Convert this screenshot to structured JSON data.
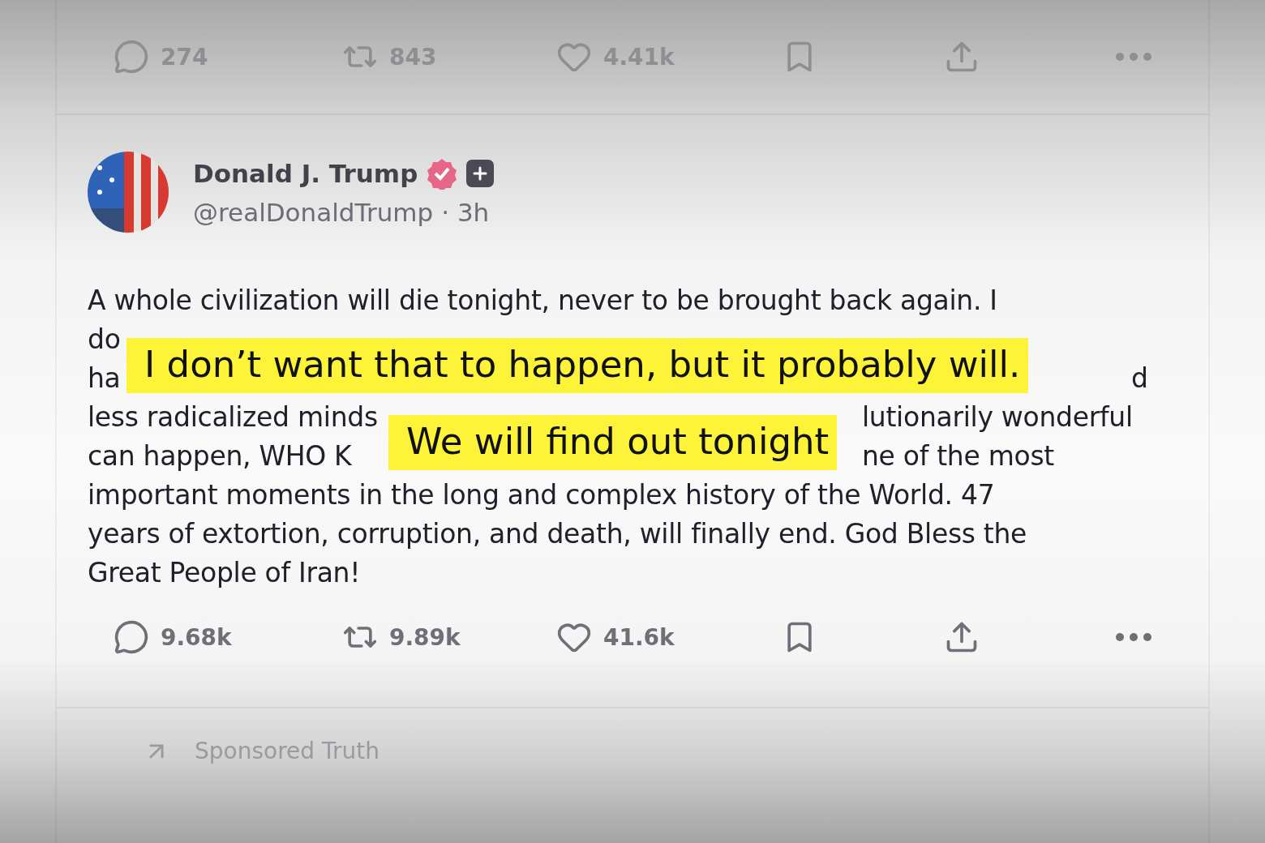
{
  "previous_post_actions": [
    {
      "kind": "reply",
      "count": "274"
    },
    {
      "kind": "repost",
      "count": "843"
    },
    {
      "kind": "like",
      "count": "4.41k"
    },
    {
      "kind": "bookmark"
    },
    {
      "kind": "share"
    },
    {
      "kind": "more"
    }
  ],
  "post": {
    "author": "Donald J. Trump",
    "verified": true,
    "handle": "@realDonaldTrump",
    "time": "· 3h",
    "body_lines": [
      [
        "A whole civilization will die tonight, never to be brought back again. I"
      ],
      [
        "do"
      ],
      [
        "ha",
        "d"
      ],
      [
        "less radicalized minds",
        "lutionarily wonderful"
      ],
      [
        "can happen, WHO K",
        "ne of the most"
      ],
      [
        "important moments in the long and complex history of the World. 47"
      ],
      [
        "years of extortion, corruption, and death, will finally end. God Bless the"
      ],
      [
        "Great People of Iran!"
      ]
    ],
    "actions": [
      {
        "kind": "reply",
        "count": "9.68k"
      },
      {
        "kind": "repost",
        "count": "9.89k"
      },
      {
        "kind": "like",
        "count": "41.6k"
      },
      {
        "kind": "bookmark"
      },
      {
        "kind": "share"
      },
      {
        "kind": "more"
      }
    ]
  },
  "highlights": [
    "I don’t want that to happen, but it probably will.",
    "We will find out tonight"
  ],
  "sponsored": {
    "label": "Sponsored Truth"
  }
}
